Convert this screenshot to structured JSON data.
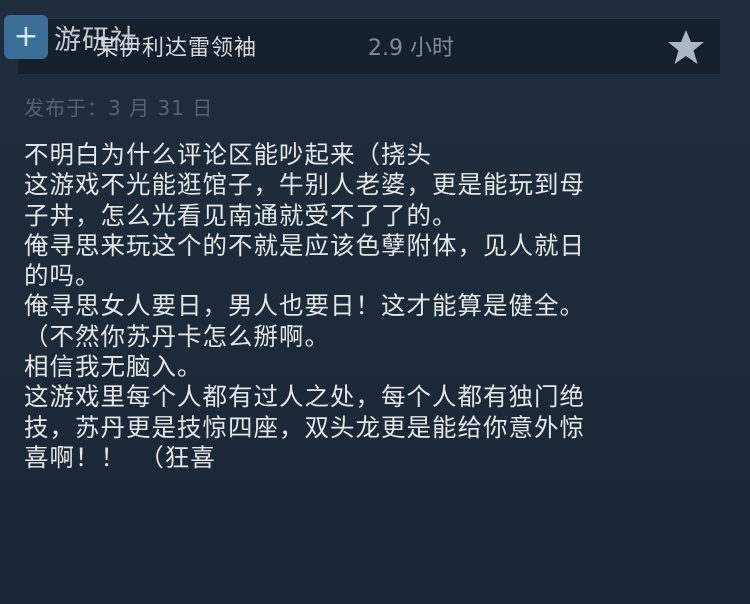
{
  "watermark": {
    "logo_glyph": "+",
    "text": "游研社"
  },
  "header": {
    "author": "某伊利达雷领袖",
    "playtime": "2.9 小时",
    "icon": "star-icon"
  },
  "post_date": "发布于：3 月 31 日",
  "review_lines": [
    "不明白为什么评论区能吵起来（挠头",
    "这游戏不光能逛馆子，牛别人老婆，更是能玩到母",
    "子丼，怎么光看见南通就受不了了的。",
    "俺寻思来玩这个的不就是应该色孽附体，见人就日",
    "的吗。",
    "俺寻思女人要日，男人也要日！这才能算是健全。",
    "（不然你苏丹卡怎么掰啊。",
    "相信我无脑入。",
    "这游戏里每个人都有过人之处，每个人都有独门绝",
    "技，苏丹更是技惊四座，双头龙更是能给你意外惊",
    "喜啊！！　（狂喜"
  ],
  "colors": {
    "background": "#1b2838",
    "header_bar": "#16202d",
    "text": "#e3e6e9",
    "muted": "#7e8c99"
  }
}
